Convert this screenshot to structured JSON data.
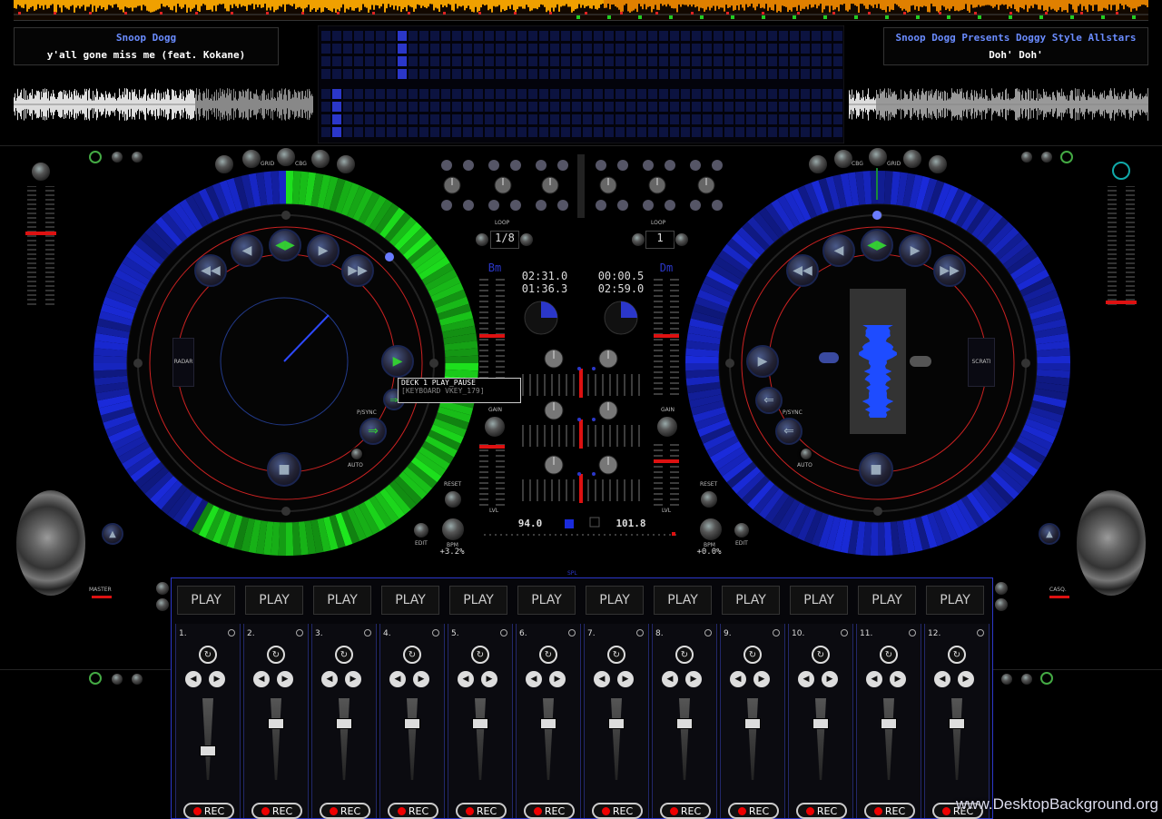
{
  "colors": {
    "accent_blue": "#2b37c9",
    "green": "#1ee81e",
    "red": "#d11",
    "bg": "#000000"
  },
  "deckA": {
    "artist": "Snoop Dogg",
    "title": "y'all gone miss me (feat. Kokane)",
    "key": "Bm",
    "elapsed": "02:31.0",
    "remaining": "01:36.3",
    "loop": "1/8",
    "bpm_value": "94.0",
    "pitch": "+3.2%",
    "labels": {
      "grid": "GRID",
      "cbg": "CBG",
      "radar": "RADAR",
      "psync": "P/SYNC",
      "auto": "AUTO",
      "gain": "GAIN",
      "reset": "RESET",
      "bpm": "BPM",
      "edit": "EDIT",
      "lvl": "LVL",
      "loop": "LOOP",
      "master": "MASTER"
    }
  },
  "deckB": {
    "artist": "Snoop Dogg Presents Doggy Style Allstars",
    "title": "Doh' Doh'",
    "key": "Dm",
    "elapsed": "00:00.5",
    "remaining": "02:59.0",
    "loop": "1",
    "bpm_value": "101.8",
    "pitch": "+0.0%",
    "labels": {
      "grid": "GRID",
      "cbg": "CBG",
      "scrat": "SCRATI",
      "psync": "P/SYNC",
      "auto": "AUTO",
      "gain": "GAIN",
      "reset": "RESET",
      "bpm": "BPM",
      "edit": "EDIT",
      "lvl": "LVL",
      "loop": "LOOP",
      "casq": "CASQ."
    }
  },
  "tooltip": {
    "line1": "DECK 1 PLAY_PAUSE",
    "line2": "[KEYBOARD VKEY_179]"
  },
  "crossfader_label": "SPL",
  "sampler": {
    "play_label": "PLAY",
    "rec_label": "REC",
    "slots": [
      {
        "num": "1.",
        "level": 0.35
      },
      {
        "num": "2.",
        "level": 0.72
      },
      {
        "num": "3.",
        "level": 0.72
      },
      {
        "num": "4.",
        "level": 0.72
      },
      {
        "num": "5.",
        "level": 0.72
      },
      {
        "num": "6.",
        "level": 0.72
      },
      {
        "num": "7.",
        "level": 0.72
      },
      {
        "num": "8.",
        "level": 0.72
      },
      {
        "num": "9.",
        "level": 0.72
      },
      {
        "num": "10.",
        "level": 0.72
      },
      {
        "num": "11.",
        "level": 0.72
      },
      {
        "num": "12.",
        "level": 0.72
      }
    ]
  },
  "deckA_disc_progress": 0.58,
  "watermark": "www.DesktopBackground.org"
}
